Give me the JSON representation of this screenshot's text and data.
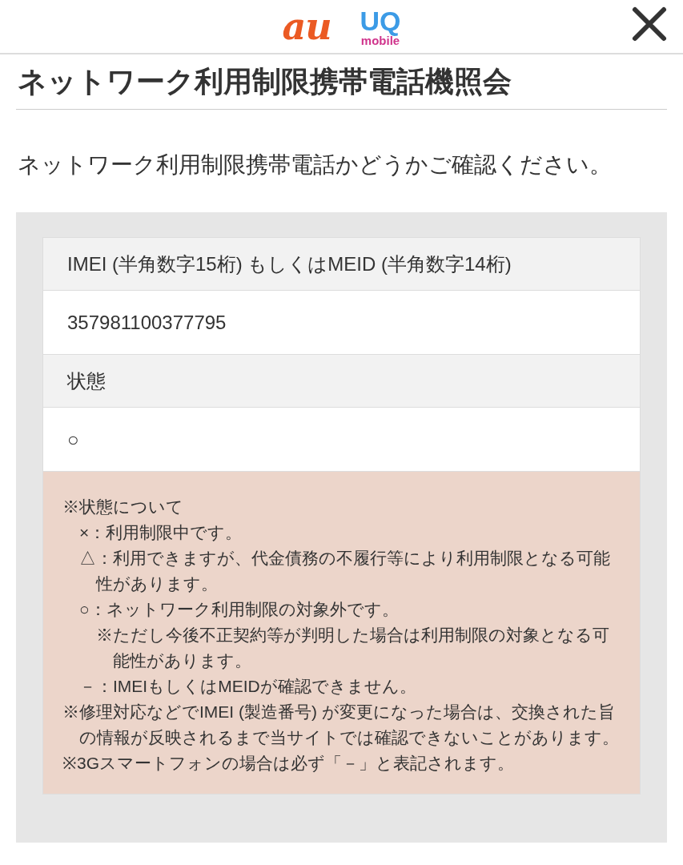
{
  "header": {
    "logos": [
      {
        "kind": "au",
        "text": "au"
      },
      {
        "kind": "uq",
        "top": "UQ",
        "bottom": "mobile"
      }
    ]
  },
  "title": "ネットワーク利用制限携帯電話機照会",
  "lead": "ネットワーク利用制限携帯電話かどうかご確認ください。",
  "fields": [
    {
      "label": "IMEI (半角数字15桁) もしくはMEID (半角数字14桁)",
      "value": "357981100377795"
    },
    {
      "label": "状態",
      "value": "○"
    }
  ],
  "notes": [
    {
      "text": "※状態について",
      "children": [
        {
          "text": "×：利用制限中です。"
        },
        {
          "text": "△：利用できますが、代金債務の不履行等により利用制限となる可能性があります。"
        },
        {
          "text": "○：ネットワーク利用制限の対象外です。",
          "children": [
            {
              "text": "※ただし今後不正契約等が判明した場合は利用制限の対象となる可能性があります。"
            }
          ]
        },
        {
          "text": "－：IMEIもしくはMEIDが確認できません。"
        }
      ]
    },
    {
      "text": "※修理対応などでIMEI (製造番号) が変更になった場合は、交換された旨の情報が反映されるまで当サイトでは確認できないことがあります。"
    },
    {
      "text": "※3Gスマートフォンの場合は必ず「－」と表記されます。"
    }
  ]
}
